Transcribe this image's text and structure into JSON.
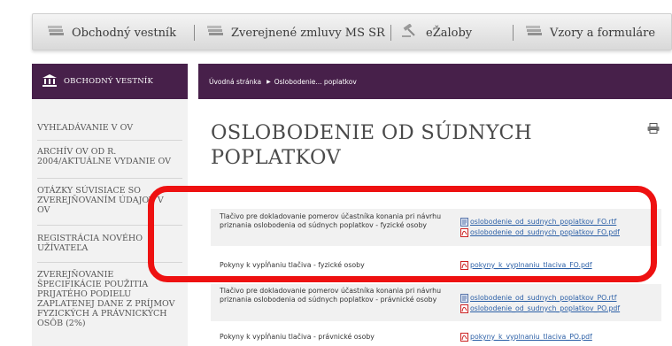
{
  "topnav": {
    "tabs": [
      {
        "label": "Obchodný vestník",
        "icon": "newspaper-stack-icon"
      },
      {
        "label": "Zverejnené zmluvy MS SR",
        "icon": "newspaper-stack-icon"
      },
      {
        "label": "eŽaloby",
        "icon": "gavel-icon"
      },
      {
        "label": "Vzory a formuláre",
        "icon": "newspaper-stack-icon"
      }
    ]
  },
  "sidebar": {
    "header": "OBCHODNÝ VESTNÍK",
    "header_icon": "courthouse-icon",
    "items": [
      {
        "label": "VYHĽADÁVANIE V OV"
      },
      {
        "label": "ARCHÍV OV OD R. 2004/AKTUÁLNE VYDANIE OV"
      },
      {
        "label": "OTÁZKY SÚVISIACE SO ZVEREJŇOVANÍM ÚDAJOV V OV"
      },
      {
        "label": "REGISTRÁCIA NOVÉHO UŽÍVATEĽA"
      },
      {
        "label": "ZVEREJŇOVANIE ŠPECIFIKÁCIE POUŽITIA PRIJATÉHO PODIELU ZAPLATENEJ DANE Z PRÍJMOV FYZICKÝCH A PRÁVNICKÝCH OSÔB (2%)"
      }
    ]
  },
  "breadcrumb": {
    "home": "Úvodná stránka",
    "current": "Oslobodenie... poplatkov"
  },
  "page": {
    "title": "OSLOBODENIE OD SÚDNYCH POPLATKOV"
  },
  "rows": [
    {
      "description": "Tlačivo pre dokladovanie pomerov účastníka konania pri návrhu priznania oslobodenia od súdnych poplatkov - fyzické osoby",
      "files": [
        {
          "name": "oslobodenie_od_sudnych_poplatkov_FO.rtf",
          "type": "rtf"
        },
        {
          "name": "oslobodenie_od_sudnych_poplatkov_FO.pdf",
          "type": "pdf"
        }
      ]
    },
    {
      "description": "Pokyny k vypĺňaniu tlačiva - fyzické osoby",
      "files": [
        {
          "name": "pokyny_k_vyplnaniu_tlaciva_FO.pdf",
          "type": "pdf"
        }
      ]
    },
    {
      "description": "Tlačivo pre dokladovanie pomerov účastníka konania pri návrhu priznania oslobodenia od súdnych poplatkov - právnické osoby",
      "files": [
        {
          "name": "oslobodenie_od_sudnych_poplatkov_PO.rtf",
          "type": "rtf"
        },
        {
          "name": "oslobodenie_od_sudnych_poplatkov_PO.pdf",
          "type": "pdf"
        }
      ]
    },
    {
      "description": "Pokyny k vypĺňaniu tlačiva - právnické osoby",
      "files": [
        {
          "name": "pokyny_k_vyplnaniu_tlaciva_PO.pdf",
          "type": "pdf"
        }
      ]
    }
  ],
  "colors": {
    "brand_purple": "#47204a",
    "link_blue": "#2b5fa6",
    "highlight_red": "#ee1111"
  }
}
